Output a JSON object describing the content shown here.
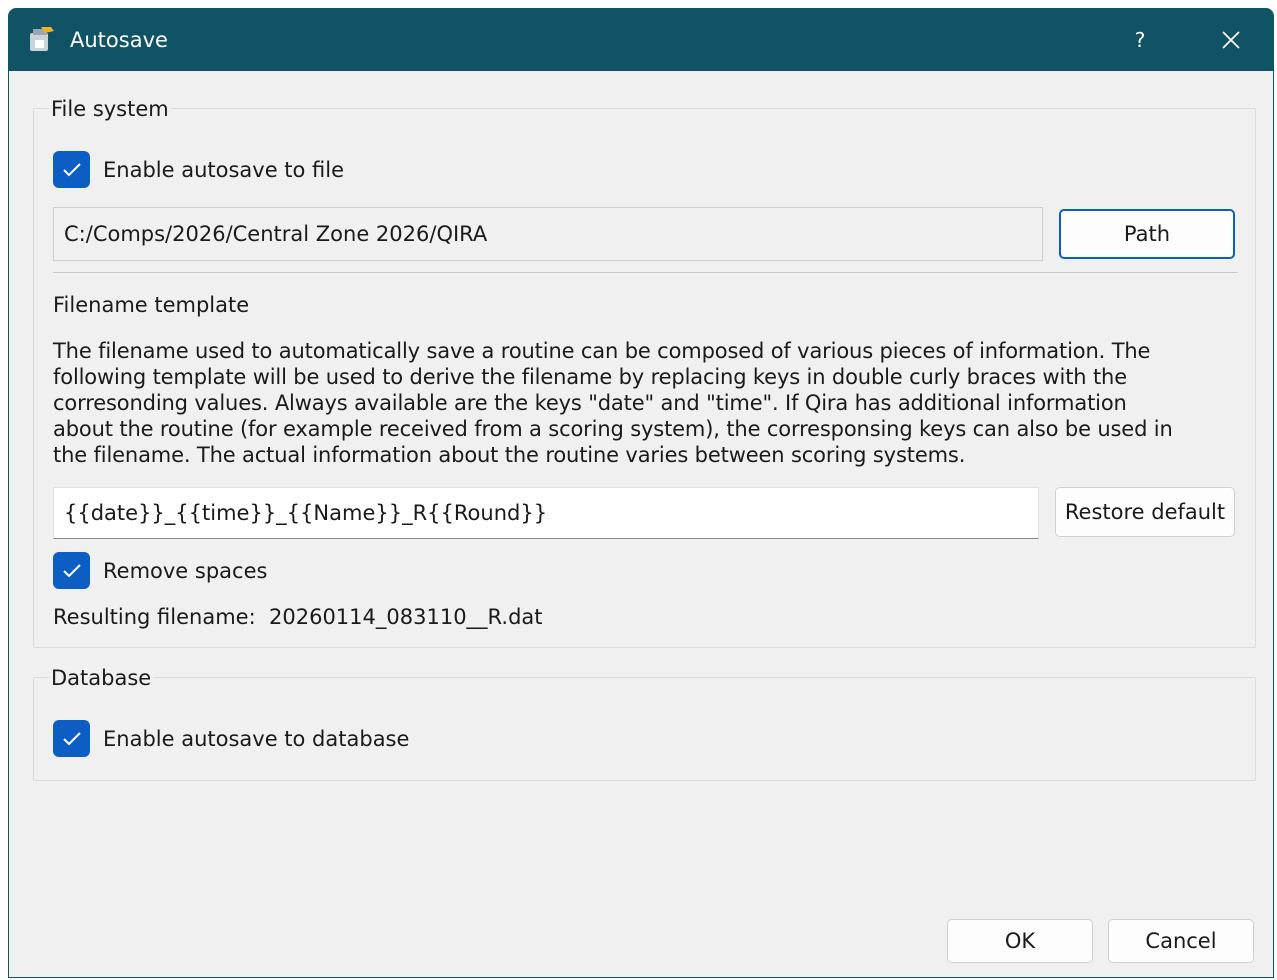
{
  "window": {
    "title": "Autosave",
    "help_label": "?"
  },
  "file_system": {
    "legend": "File system",
    "enable_label": "Enable autosave to file",
    "enable_checked": true,
    "path_value": "C:/Comps/2026/Central Zone 2026/QIRA",
    "path_button": "Path",
    "template_heading": "Filename template",
    "description_lines": [
      "The filename used to automatically save a routine can be composed of various pieces of information. The",
      "following template will be used to derive the filename by replacing keys in double curly braces with the",
      "corresonding values. Always available are the keys \"date\" and \"time\". If Qira has additional information",
      "about the routine (for example received from a scoring system), the corresponsing keys can also be used in",
      "the filename. The actual information about the routine varies between scoring systems."
    ],
    "template_value": "{{date}}_{{time}}_{{Name}}_R{{Round}}",
    "restore_button": "Restore default",
    "remove_spaces_label": "Remove spaces",
    "remove_spaces_checked": true,
    "resulting_label": "Resulting filename:",
    "resulting_value": "20260114_083110__R.dat"
  },
  "database": {
    "legend": "Database",
    "enable_label": "Enable autosave to database",
    "enable_checked": true
  },
  "footer": {
    "ok_label": "OK",
    "cancel_label": "Cancel"
  },
  "colors": {
    "titlebar": "#0f5365",
    "accent": "#0d5ec4",
    "background": "#f0f0f0"
  },
  "icons": {
    "app": "app-icon",
    "help": "help-icon",
    "close": "close-icon",
    "check": "check-icon"
  }
}
